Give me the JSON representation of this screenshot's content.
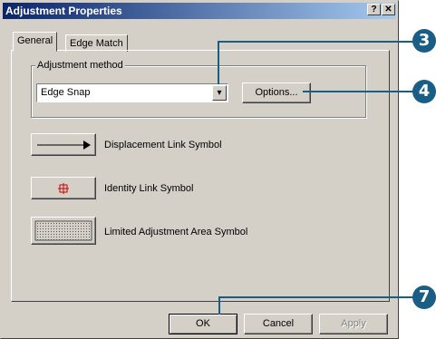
{
  "window": {
    "title": "Adjustment Properties",
    "help_btn": "?",
    "close_btn": "✕"
  },
  "tabs": [
    {
      "label": "General",
      "active": true
    },
    {
      "label": "Edge Match",
      "active": false
    }
  ],
  "adjustment_group": {
    "label": "Adjustment method",
    "combo_value": "Edge Snap",
    "combo_arrow": "▾",
    "options_button": "Options..."
  },
  "symbols": [
    {
      "label": "Displacement Link Symbol"
    },
    {
      "label": "Identity Link Symbol"
    },
    {
      "label": "Limited Adjustment Area Symbol"
    }
  ],
  "footer": {
    "ok": "OK",
    "cancel": "Cancel",
    "apply": "Apply"
  },
  "callouts": [
    {
      "number": "3"
    },
    {
      "number": "4"
    },
    {
      "number": "7"
    }
  ]
}
